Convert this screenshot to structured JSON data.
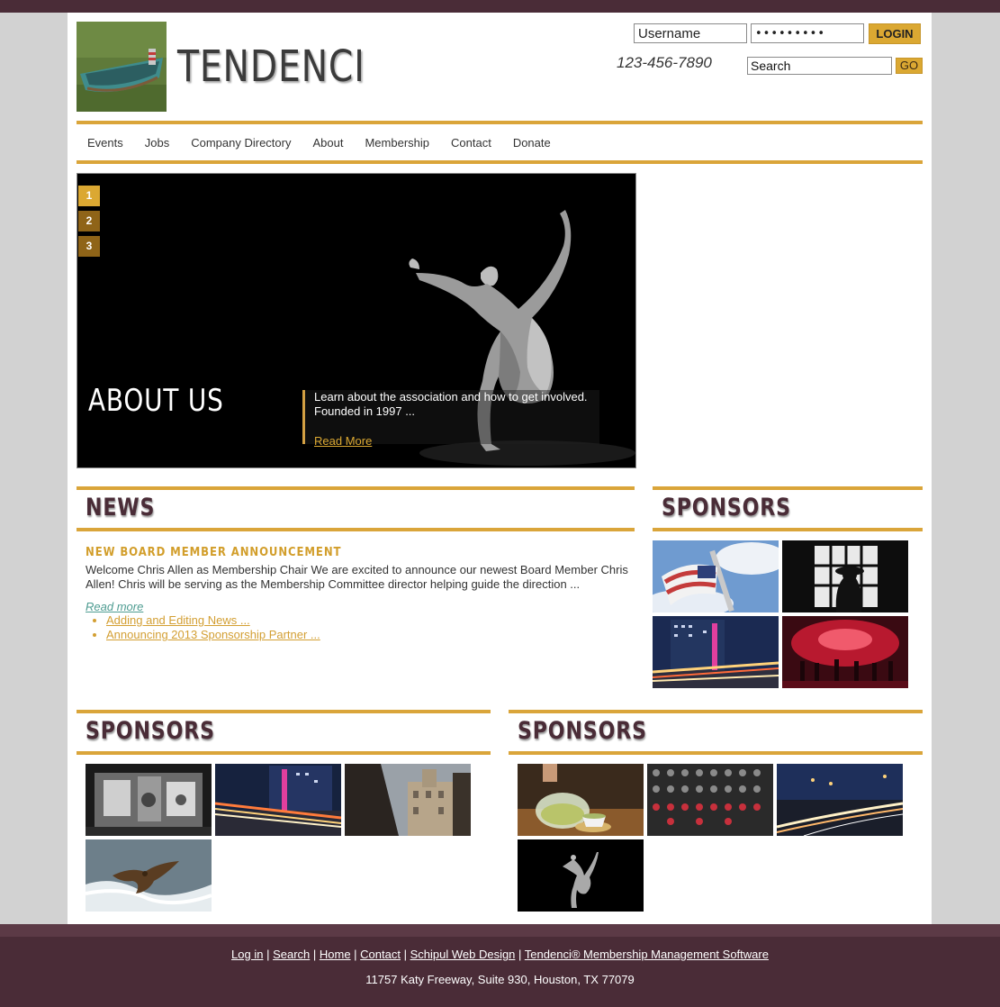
{
  "header": {
    "site_title": "TENDENCI",
    "username_value": "Username",
    "password_value": "•••••••••",
    "login_label": "LOGIN",
    "phone": "123-456-7890",
    "search_value": "Search",
    "go_label": "GO"
  },
  "nav": [
    "Events",
    "Jobs",
    "Company Directory",
    "About",
    "Membership",
    "Contact",
    "Donate"
  ],
  "slider": {
    "numbers": [
      "1",
      "2",
      "3"
    ],
    "active": 1,
    "title": "ABOUT US",
    "text": "Learn about the association and how to get involved. Founded in 1997 ...",
    "link": "Read More"
  },
  "news": {
    "heading": "NEWS",
    "article_title": "NEW BOARD MEMBER ANNOUNCEMENT",
    "article_body": "Welcome Chris Allen as Membership Chair We are excited to announce our newest Board Member Chris Allen! Chris will be serving as the Membership Committee director helping guide the direction ...",
    "read_more": "Read more",
    "links": [
      "Adding and Editing News ...",
      "Announcing 2013 Sponsorship Partner ..."
    ]
  },
  "sponsors": {
    "right_heading": "SPONSORS",
    "left_heading": "SPONSORS",
    "mid_heading": "SPONSORS"
  },
  "footer": {
    "links": [
      "Log in",
      "Search",
      "Home",
      "Contact",
      "Schipul Web Design",
      "Tendenci® Membership Management Software"
    ],
    "separator": " | ",
    "address": "11757 Katy Freeway, Suite 930, Houston, TX 77079"
  },
  "colors": {
    "accent": "#daa53a",
    "brand_dark": "#4a2c37"
  }
}
